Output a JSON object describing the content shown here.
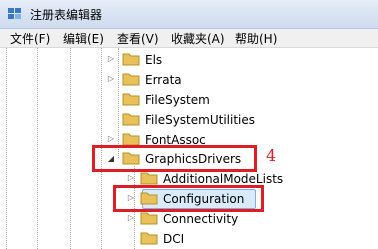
{
  "window": {
    "title": "注册表编辑器"
  },
  "menu": [
    "文件(F)",
    "编辑(E)",
    "查看(V)",
    "收藏夹(A)",
    "帮助(H)"
  ],
  "tree": [
    {
      "label": "Els",
      "expander": "▷"
    },
    {
      "label": "Errata",
      "expander": "▷"
    },
    {
      "label": "FileSystem",
      "expander": ""
    },
    {
      "label": "FileSystemUtilities",
      "expander": ""
    },
    {
      "label": "FontAssoc",
      "expander": "▷"
    },
    {
      "label": "GraphicsDrivers",
      "expander": "◢"
    },
    {
      "label": "AdditionalModeLists",
      "expander": "▷"
    },
    {
      "label": "Configuration",
      "expander": "▷"
    },
    {
      "label": "Connectivity",
      "expander": "▷"
    },
    {
      "label": "DCI",
      "expander": ""
    }
  ],
  "annotation": {
    "number": "4"
  },
  "colors": {
    "folder": "#e8c15a",
    "annotation": "#e01c24",
    "selection": "#d9ebfa"
  }
}
